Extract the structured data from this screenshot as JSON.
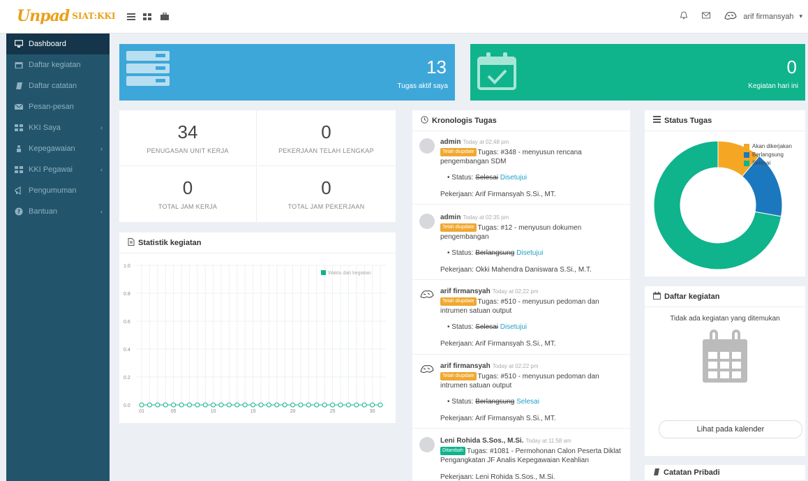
{
  "brand": {
    "logo_mark": "Unpad",
    "logo_text": "SIAT:KKI"
  },
  "topbar": {
    "icons": [
      "list-icon",
      "grid-icon",
      "briefcase-icon"
    ],
    "user_name": "arif firmansyah",
    "caret": "▾"
  },
  "sidebar": {
    "items": [
      {
        "label": "Dashboard",
        "icon": "desktop-icon",
        "chevron": ""
      },
      {
        "label": "Daftar kegiatan",
        "icon": "calendar-icon",
        "chevron": ""
      },
      {
        "label": "Daftar catatan",
        "icon": "note-icon",
        "chevron": ""
      },
      {
        "label": "Pesan-pesan",
        "icon": "envelope-icon",
        "chevron": ""
      },
      {
        "label": "KKI Saya",
        "icon": "table-icon",
        "chevron": "‹"
      },
      {
        "label": "Kepegawaian",
        "icon": "person-icon",
        "chevron": "‹"
      },
      {
        "label": "KKI Pegawai",
        "icon": "table-icon",
        "chevron": "‹"
      },
      {
        "label": "Pengumuman",
        "icon": "bullhorn-icon",
        "chevron": ""
      },
      {
        "label": "Bantuan",
        "icon": "question-icon",
        "chevron": "‹"
      }
    ]
  },
  "banners": {
    "tasks": {
      "value": "13",
      "label": "Tugas aktif saya",
      "color": "#3ea7d9"
    },
    "today": {
      "value": "0",
      "label": "Kegiatan hari ini",
      "color": "#0fb38c"
    }
  },
  "stats": [
    {
      "value": "34",
      "label": "PENUGASAN UNIT KERJA"
    },
    {
      "value": "0",
      "label": "PEKERJAAN TELAH LENGKAP"
    },
    {
      "value": "0",
      "label": "TOTAL JAM KERJA"
    },
    {
      "value": "0",
      "label": "TOTAL JAM PEKERJAAN"
    }
  ],
  "statistik": {
    "title": "Statistik kegiatan",
    "legend": "Waktu dari kegiatan"
  },
  "chart_data": {
    "type": "line",
    "title": "Statistik kegiatan",
    "yticks": [
      "1.0",
      "0.8",
      "0.6",
      "0.4",
      "0.2",
      "0.0"
    ],
    "xticks": [
      "01",
      "05",
      "10",
      "15",
      "20",
      "25",
      "30"
    ],
    "ylim": [
      0,
      1
    ],
    "x": [
      1,
      2,
      3,
      4,
      5,
      6,
      7,
      8,
      9,
      10,
      11,
      12,
      13,
      14,
      15,
      16,
      17,
      18,
      19,
      20,
      21,
      22,
      23,
      24,
      25,
      26,
      27,
      28,
      29,
      30,
      31
    ],
    "series": [
      {
        "name": "Waktu dari kegiatan",
        "values": [
          0,
          0,
          0,
          0,
          0,
          0,
          0,
          0,
          0,
          0,
          0,
          0,
          0,
          0,
          0,
          0,
          0,
          0,
          0,
          0,
          0,
          0,
          0,
          0,
          0,
          0,
          0,
          0,
          0,
          0,
          0
        ]
      }
    ],
    "grid": true,
    "legend_position": "top-right"
  },
  "kronologi": {
    "title": "Kronologis Tugas",
    "items": [
      {
        "user": "admin",
        "time": "Today at 02:48 pm",
        "badge": "Telah diupdate",
        "badge_color": "#f0a830",
        "text": "Tugas: #348 - menyusun rencana pengembangan SDM",
        "status_label": "Status:",
        "status_old": "Selesai",
        "status_new": "Disetujui",
        "job": "Pekerjaan: Arif Firmansyah S.Si., MT.",
        "avatar": "blank"
      },
      {
        "user": "admin",
        "time": "Today at 02:35 pm",
        "badge": "Telah diupdate",
        "badge_color": "#f0a830",
        "text": "Tugas: #12 - menyusun dokumen pengembangan",
        "status_label": "Status:",
        "status_old": "Berlangsung",
        "status_new": "Disetujui",
        "job": "Pekerjaan: Okki Mahendra Daniswara S.Si., M.T.",
        "avatar": "blank"
      },
      {
        "user": "arif firmansyah",
        "time": "Today at 02:22 pm",
        "badge": "Telah diupdate",
        "badge_color": "#f0a830",
        "text": "Tugas: #510 - menyusun pedoman dan intrumen satuan output",
        "status_label": "Status:",
        "status_old": "Selesai",
        "status_new": "Disetujui",
        "job": "Pekerjaan: Arif Firmansyah S.Si., MT.",
        "avatar": "sketch"
      },
      {
        "user": "arif firmansyah",
        "time": "Today at 02:22 pm",
        "badge": "Telah diupdate",
        "badge_color": "#f0a830",
        "text": "Tugas: #510 - menyusun pedoman dan intrumen satuan output",
        "status_label": "Status:",
        "status_old": "Berlangsung",
        "status_new": "Selesai",
        "job": "Pekerjaan: Arif Firmansyah S.Si., MT.",
        "avatar": "sketch"
      },
      {
        "user": "Leni Rohida S.Sos., M.Si.",
        "time": "Today at 11:58 am",
        "badge": "Ditambah",
        "badge_color": "#0fb38c",
        "text": "Tugas: #1081 - Permohonan Calon Peserta Diklat Pengangkatan JF Analis Kepegawaian Keahlian",
        "job": "Pekerjaan: Leni Rohida S.Sos., M.Si.",
        "avatar": "blank"
      }
    ]
  },
  "status_tugas": {
    "title": "Status Tugas",
    "legend": [
      {
        "label": "Akan dikerjakan",
        "color": "#f5a623"
      },
      {
        "label": "Berlangsung",
        "color": "#1b78bf"
      },
      {
        "label": "Selesai",
        "color": "#0fb38c"
      }
    ],
    "values": [
      2,
      3,
      13
    ]
  },
  "daftar_kegiatan": {
    "title": "Daftar kegiatan",
    "empty": "Tidak ada kegiatan yang ditemukan",
    "button": "Lihat pada kalender"
  },
  "catatan": {
    "title": "Catatan Pribadi"
  }
}
